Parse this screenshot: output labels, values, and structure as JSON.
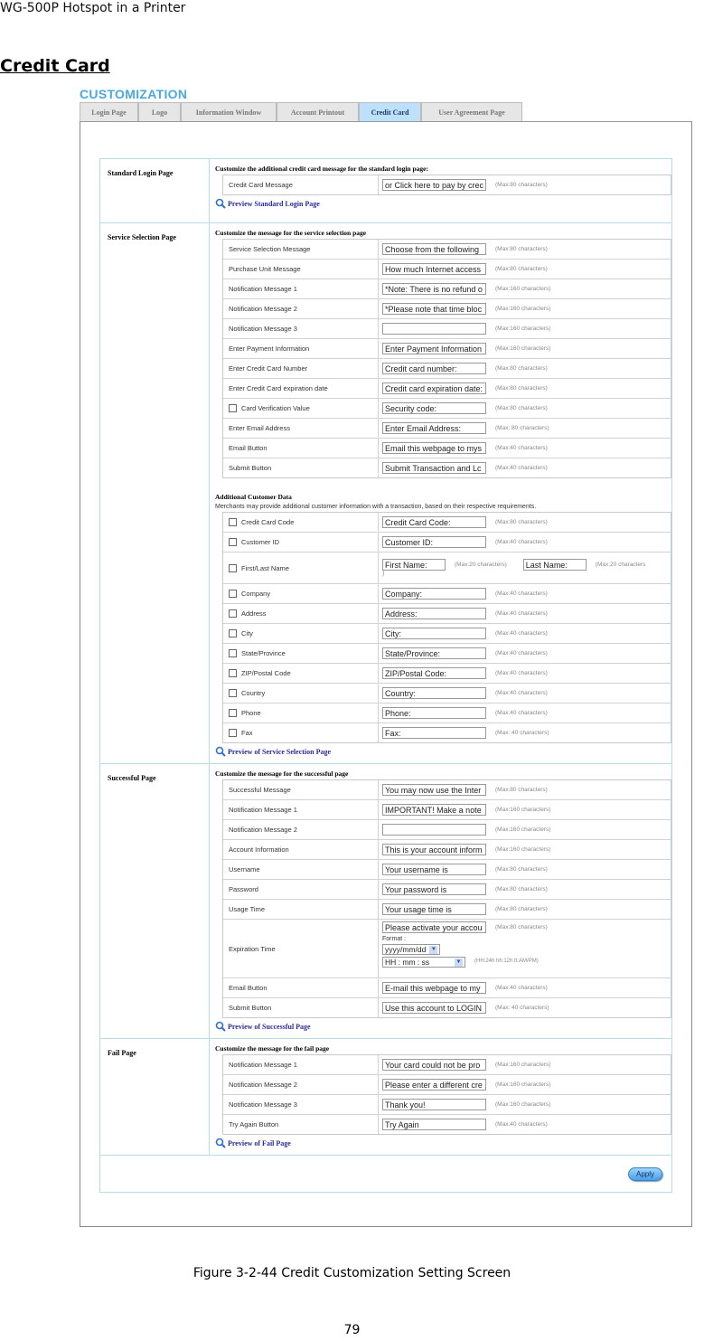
{
  "doc": {
    "header": "WG-500P Hotspot in a Printer",
    "section_title": "Credit Card",
    "caption": "Figure 3-2-44 Credit Customization Setting Screen",
    "page_number": "79"
  },
  "ui": {
    "title": "CUSTOMIZATION",
    "tabs": [
      {
        "label": "Login Page",
        "active": false
      },
      {
        "label": "Logo",
        "active": false
      },
      {
        "label": "Information Window",
        "active": false
      },
      {
        "label": "Account Printout",
        "active": false
      },
      {
        "label": "Credit Card",
        "active": true
      },
      {
        "label": "User Agreement Page",
        "active": false
      }
    ],
    "sections": {
      "standard_login": {
        "label": "Standard Login Page",
        "heading": "Customize the additional credit card message for the standard login page:",
        "fields": [
          {
            "label": "Credit Card Message",
            "value": "or Click here to pay by crec",
            "max": "(Max:80 characters)"
          }
        ],
        "preview": "Preview Standard Login Page"
      },
      "service_selection": {
        "label": "Service Selection Page",
        "heading": "Customize the message for the service selection page",
        "fields": [
          {
            "label": "Service Selection Message",
            "value": "Choose from the following",
            "max": "(Max:80 characters)"
          },
          {
            "label": "Purchase Unit Message",
            "value": "How much Internet access",
            "max": "(Max:80 characters)"
          },
          {
            "label": "Notification Message 1",
            "value": "*Note: There is no refund o",
            "max": "(Max:160 characters)"
          },
          {
            "label": "Notification Message 2",
            "value": "*Please note that time bloc",
            "max": "(Max:160 characters)"
          },
          {
            "label": "Notification Message 3",
            "value": "",
            "max": "(Max:160 characters)"
          },
          {
            "label": "Enter Payment Information",
            "value": "Enter Payment Information",
            "max": "(Max:160 characters)"
          },
          {
            "label": "Enter Credit Card Number",
            "value": "Credit card number:",
            "max": "(Max:80 characters)"
          },
          {
            "label": "Enter Credit Card expiration date",
            "value": "Credit card expiration date:",
            "max": "(Max:80 characters)"
          },
          {
            "label": "Card Verification Value",
            "value": "Security code:",
            "max": "(Max:80 characters)",
            "checkbox": true
          },
          {
            "label": "Enter Email Address",
            "value": "Enter Email Address:",
            "max": "(Max: 80 characters)"
          },
          {
            "label": "Email Button",
            "value": "Email this webpage to mys",
            "max": "(Max:40 characters)"
          },
          {
            "label": "Submit Button",
            "value": "Submit Transaction and Lc",
            "max": "(Max:40 characters)"
          }
        ],
        "additional_heading": "Additional Customer Data",
        "additional_desc": "Merchants may provide additional customer information with a transaction, based on their respective requirements.",
        "additional_fields": [
          {
            "label": "Credit Card Code",
            "value": "Credit Card Code:",
            "max": "(Max:80 characters)"
          },
          {
            "label": "Customer ID",
            "value": "Customer ID:",
            "max": "(Max:40 characters)"
          },
          {
            "label": "First/Last Name",
            "first_value": "First Name:",
            "first_max": "(Max:20 characters)",
            "last_value": "Last Name:",
            "last_max": "(Max:20 characters",
            "overflow": ")"
          },
          {
            "label": "Company",
            "value": "Company:",
            "max": "(Max:40 characters)"
          },
          {
            "label": "Address",
            "value": "Address:",
            "max": "(Max:40 characters)"
          },
          {
            "label": "City",
            "value": "City:",
            "max": "(Max:40 characters)"
          },
          {
            "label": "State/Province",
            "value": "State/Province:",
            "max": "(Max:40 characters)"
          },
          {
            "label": "ZIP/Postal Code",
            "value": "ZIP/Postal Code:",
            "max": "(Max:40 characters)"
          },
          {
            "label": "Country",
            "value": "Country:",
            "max": "(Max:40 characters)"
          },
          {
            "label": "Phone",
            "value": "Phone:",
            "max": "(Max:40 characters)"
          },
          {
            "label": "Fax",
            "value": "Fax:",
            "max": "(Max: 40 characters)"
          }
        ],
        "preview": "Preview of Service Selection Page"
      },
      "successful": {
        "label": "Successful Page",
        "heading": "Customize the message for the successful page",
        "fields": [
          {
            "label": "Successful Message",
            "value": "You may now use the Inter",
            "max": "(Max:80 characters)"
          },
          {
            "label": "Notification Message 1",
            "value": "IMPORTANT! Make a note",
            "max": "(Max:160 characters)"
          },
          {
            "label": "Notification Message 2",
            "value": "",
            "max": "(Max:160 characters)"
          },
          {
            "label": "Account Information",
            "value": "This is your account inform",
            "max": "(Max:160 characters)"
          },
          {
            "label": "Username",
            "value": "Your username is",
            "max": "(Max:80 characters)"
          },
          {
            "label": "Password",
            "value": "Your password is",
            "max": "(Max:80 characters)"
          },
          {
            "label": "Usage Time",
            "value": "Your usage time is",
            "max": "(Max:80 characters)"
          }
        ],
        "expiration": {
          "label": "Expiration Time",
          "value": "Please activate your accou",
          "max": "(Max:80 characters)",
          "format_label": "Format :",
          "date_format": "yyyy/mm/dd",
          "time_format": "HH : mm : ss",
          "time_hint": "(HH:24h hh:12h tt:AM/PM)"
        },
        "fields_after": [
          {
            "label": "Email Button",
            "value": "E-mail this webpage to my",
            "max": "(Max:40 characters)"
          },
          {
            "label": "Submit Button",
            "value": "Use this account to LOGIN",
            "max": "(Max: 40 characters)"
          }
        ],
        "preview": "Preview of Successful Page"
      },
      "fail": {
        "label": "Fail Page",
        "heading": "Customize the message for the fail page",
        "fields": [
          {
            "label": "Notification Message 1",
            "value": "Your card could not be pro",
            "max": "(Max:160 characters)"
          },
          {
            "label": "Notification Message 2",
            "value": "Please enter a different cre",
            "max": "(Max:160 characters)"
          },
          {
            "label": "Notification Message 3",
            "value": "Thank you!",
            "max": "(Max:160 characters)"
          },
          {
            "label": "Try Again Button",
            "value": "Try Again",
            "max": "(Max:40 characters)"
          }
        ],
        "preview": "Preview of Fail Page"
      }
    },
    "apply_label": "Apply",
    "colors": {
      "title": "#4aa8dd",
      "active_tab": "#bfe0fb",
      "link": "#2a2a9c",
      "section_border": "#b9dbe6"
    }
  }
}
